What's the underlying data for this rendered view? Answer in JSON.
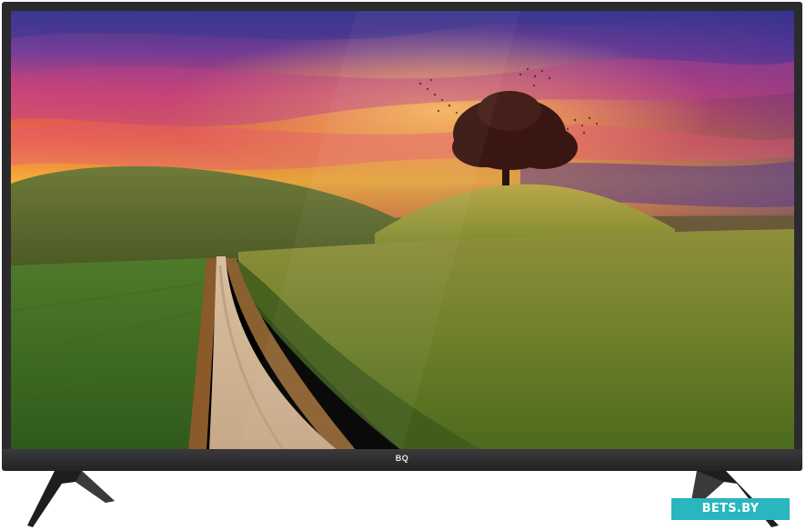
{
  "tv": {
    "brand_logo": "BQ",
    "screen_image": "rolling-green-hills-sunset-dirt-road-tree"
  },
  "watermark": {
    "text": "BETS.BY"
  },
  "colors": {
    "frame": "#2b2b2d",
    "watermark_bg": "#29b6bf"
  }
}
